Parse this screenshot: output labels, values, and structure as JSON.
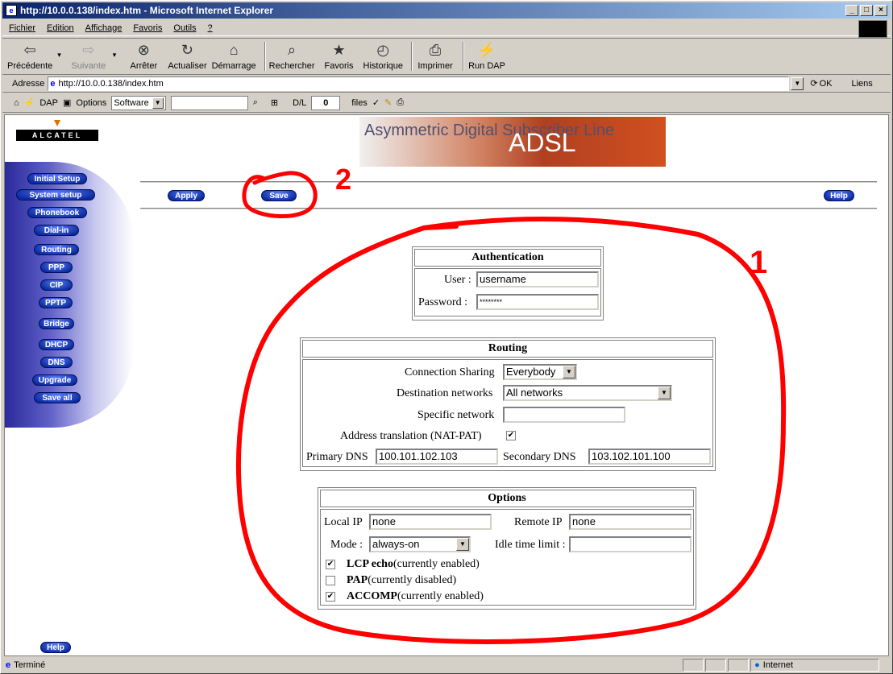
{
  "window": {
    "title": "http://10.0.0.138/index.htm - Microsoft Internet Explorer"
  },
  "menu": [
    "Fichier",
    "Edition",
    "Affichage",
    "Favoris",
    "Outils",
    "?"
  ],
  "toolbar": [
    {
      "label": "Précédente",
      "icon": "back-arrow-icon",
      "glyph": "⇦",
      "disabled": false
    },
    {
      "label": "Suivante",
      "icon": "forward-arrow-icon",
      "glyph": "⇨",
      "disabled": true
    },
    {
      "label": "Arrêter",
      "icon": "stop-icon",
      "glyph": "⊗",
      "disabled": false
    },
    {
      "label": "Actualiser",
      "icon": "refresh-icon",
      "glyph": "↻",
      "disabled": false
    },
    {
      "label": "Démarrage",
      "icon": "home-icon",
      "glyph": "⌂",
      "disabled": false
    },
    {
      "label": "Rechercher",
      "icon": "search-icon",
      "glyph": "⌕",
      "disabled": false
    },
    {
      "label": "Favoris",
      "icon": "favorites-icon",
      "glyph": "★",
      "disabled": false
    },
    {
      "label": "Historique",
      "icon": "history-icon",
      "glyph": "◴",
      "disabled": false
    },
    {
      "label": "Imprimer",
      "icon": "print-icon",
      "glyph": "⎙",
      "disabled": false
    },
    {
      "label": "Run DAP",
      "icon": "run-dap-icon",
      "glyph": "⚡",
      "disabled": false
    }
  ],
  "address": {
    "label": "Adresse",
    "url": "http://10.0.0.138/index.htm",
    "go": "OK",
    "links": "Liens"
  },
  "linksbar": {
    "dap": "DAP",
    "options": "Options",
    "category": "Software",
    "dl_label": "D/L",
    "dl_count": "0",
    "files": "files"
  },
  "status": {
    "text": "Terminé",
    "zone": "Internet"
  },
  "page": {
    "logo": "ALCATEL",
    "banner_line": "Asymmetric Digital Subscriber Line",
    "banner_big": "ADSL",
    "nav": [
      "Initial Setup",
      "System setup",
      "Phonebook",
      "Dial-in",
      "Routing",
      "PPP",
      "CIP",
      "PPTP",
      "Bridge",
      "DHCP",
      "DNS",
      "Upgrade",
      "Save all"
    ],
    "help_left": "Help",
    "apply": "Apply",
    "save": "Save",
    "help": "Help",
    "auth": {
      "title": "Authentication",
      "user_label": "User :",
      "user_value": "username",
      "pass_label": "Password :",
      "pass_value": "********"
    },
    "routing": {
      "title": "Routing",
      "sharing_label": "Connection Sharing",
      "sharing_value": "Everybody",
      "dest_label": "Destination networks",
      "dest_value": "All networks",
      "specific_label": "Specific network",
      "specific_value": "",
      "nat_label": "Address translation (NAT-PAT)",
      "nat_checked": true,
      "dns1_label": "Primary DNS",
      "dns1_value": "100.101.102.103",
      "dns2_label": "Secondary DNS",
      "dns2_value": "103.102.101.100"
    },
    "options": {
      "title": "Options",
      "local_label": "Local IP",
      "local_value": "none",
      "remote_label": "Remote IP",
      "remote_value": "none",
      "mode_label": "Mode :",
      "mode_value": "always-on",
      "idle_label": "Idle time limit :",
      "idle_value": "",
      "lcp_name": "LCP echo",
      "lcp_state": "(currently enabled)",
      "lcp_checked": true,
      "pap_name": "PAP",
      "pap_state": "(currently disabled)",
      "pap_checked": false,
      "accomp_name": "ACCOMP",
      "accomp_state": "(currently enabled)",
      "accomp_checked": true
    }
  },
  "annotations": {
    "one": "1",
    "two": "2",
    "color": "#ff0000"
  }
}
